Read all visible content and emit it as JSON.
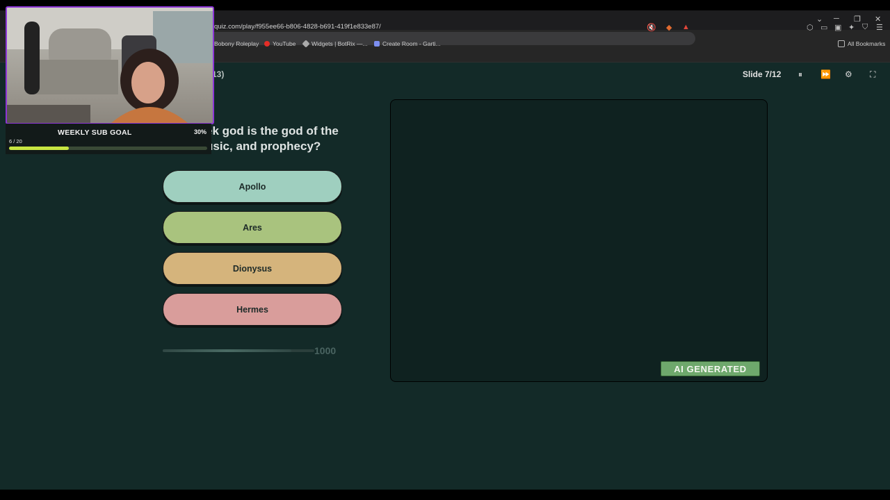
{
  "browser": {
    "url": "quiz.com/play/f955ee66-b806-4828-b691-419f1e833e87/",
    "bookmarks": [
      "Bobony Roleplay",
      "YouTube",
      "Widgets | BotRix —...",
      "Create Room - Garti..."
    ],
    "all_bookmarks": "All Bookmarks",
    "window_controls": {
      "minimize": "─",
      "restore": "❐",
      "close": "✕",
      "tabs": "⌄"
    }
  },
  "quiz": {
    "question_number": "13)",
    "slide": "Slide 7/12",
    "question_line1": "ek god is the god of the",
    "question_line2": "usic, and prophecy?",
    "answers": [
      {
        "label": "Apollo",
        "color": "#9fcfbf"
      },
      {
        "label": "Ares",
        "color": "#a9c37e"
      },
      {
        "label": "Dionysus",
        "color": "#d5b47c"
      },
      {
        "label": "Hermes",
        "color": "#d99d9b"
      }
    ],
    "timer_fraction": 0.85,
    "points": "1000",
    "ai_badge": "AI GENERATED",
    "controls": {
      "pause": "⏸",
      "skip": "⏩",
      "settings": "⚙",
      "fullscreen": "⛶"
    }
  },
  "overlay": {
    "goal_title": "WEEKLY SUB GOAL",
    "goal_percent": "30%",
    "goal_count": "6 / 20",
    "goal_fraction": 0.3,
    "border_color": "#8c35d6"
  }
}
